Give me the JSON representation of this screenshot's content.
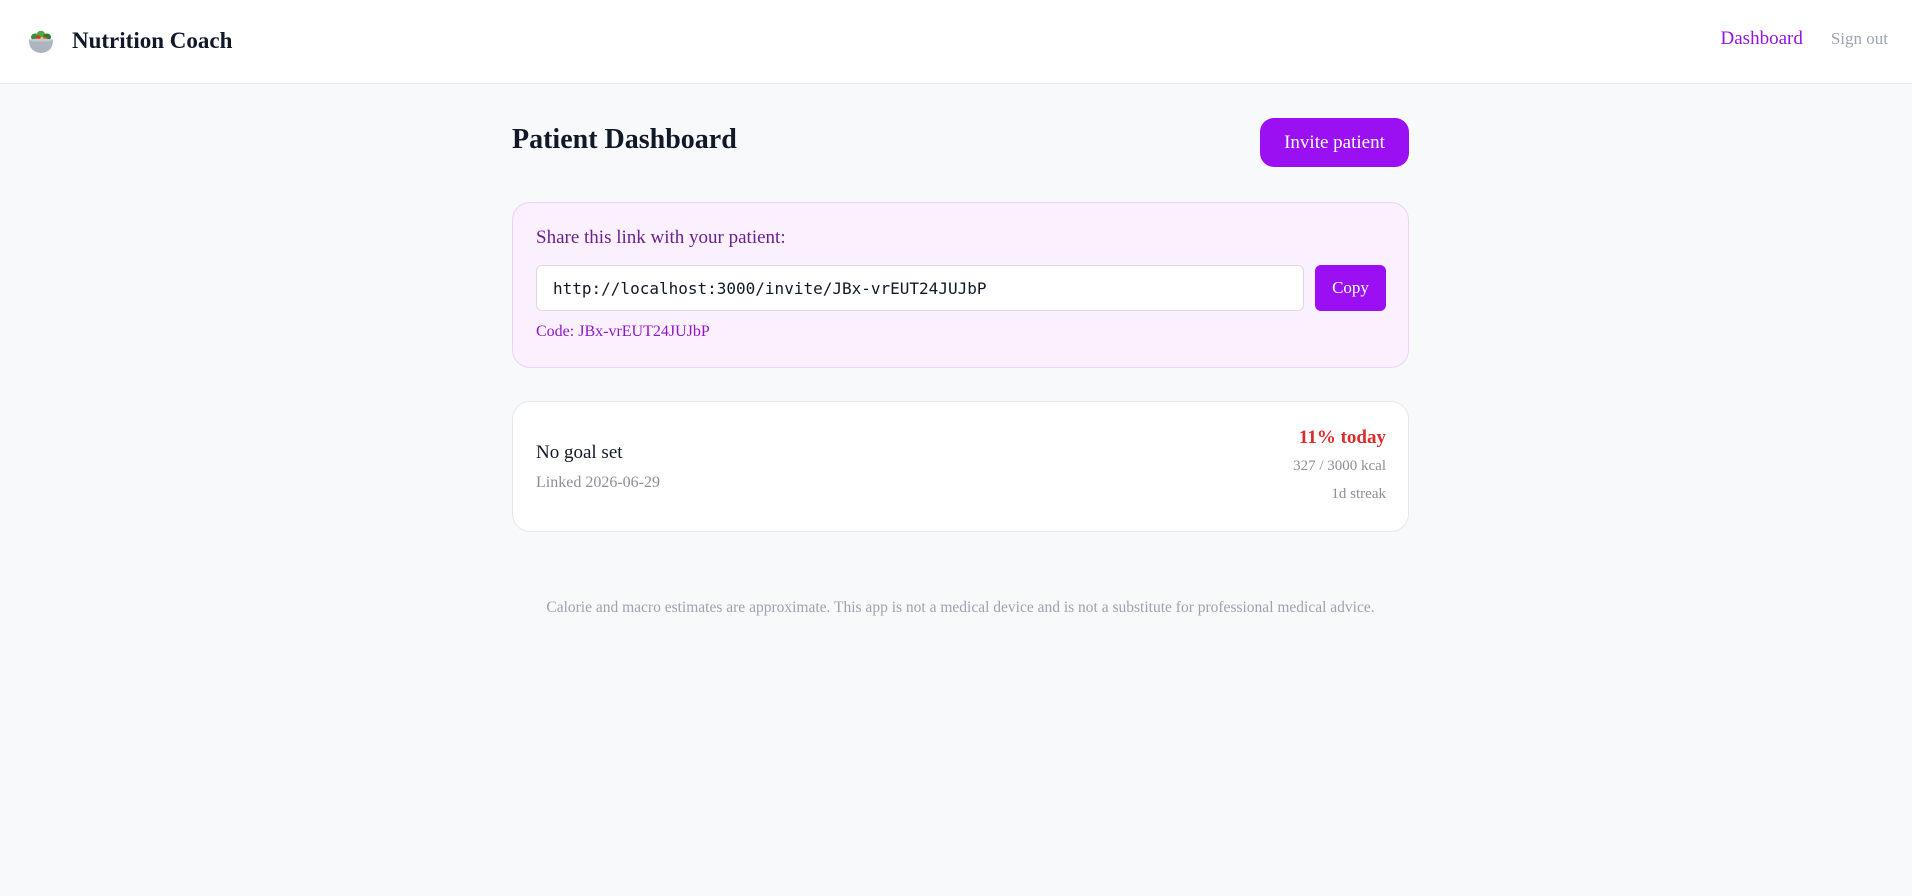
{
  "header": {
    "app_name": "Nutrition Coach",
    "logo_icon": "salad-bowl-icon",
    "nav": {
      "dashboard": "Dashboard",
      "sign_out": "Sign out"
    }
  },
  "main": {
    "title": "Patient Dashboard",
    "invite_button": "Invite patient",
    "share": {
      "label": "Share this link with your patient:",
      "link": "http://localhost:3000/invite/JBx-vrEUT24JUJbP",
      "copy_button": "Copy",
      "code_text": "Code: JBx-vrEUT24JUJbP"
    },
    "patient": {
      "goal": "No goal set",
      "linked": "Linked 2026-06-29",
      "percent_today": "11% today",
      "kcal": "327 / 3000 kcal",
      "streak": "1d streak"
    },
    "disclaimer": "Calorie and macro estimates are approximate. This app is not a medical device and is not a substitute for professional medical advice."
  },
  "colors": {
    "accent": "#9b10f2",
    "share_bg": "#fbf1fe",
    "alert_red": "#dc2b2b",
    "page_bg": "#f8f9fb"
  }
}
